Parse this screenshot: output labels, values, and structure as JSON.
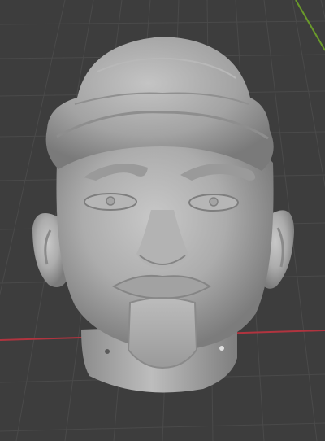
{
  "viewport": {
    "background": "#3d3d3d",
    "grid_color": "#4a4a4a",
    "x_axis_color": "#b0343f",
    "y_axis_color": "#6a9a2a"
  },
  "model": {
    "type": "sculpted-head",
    "material_color": "#a9a9a9",
    "shading": "solid"
  }
}
